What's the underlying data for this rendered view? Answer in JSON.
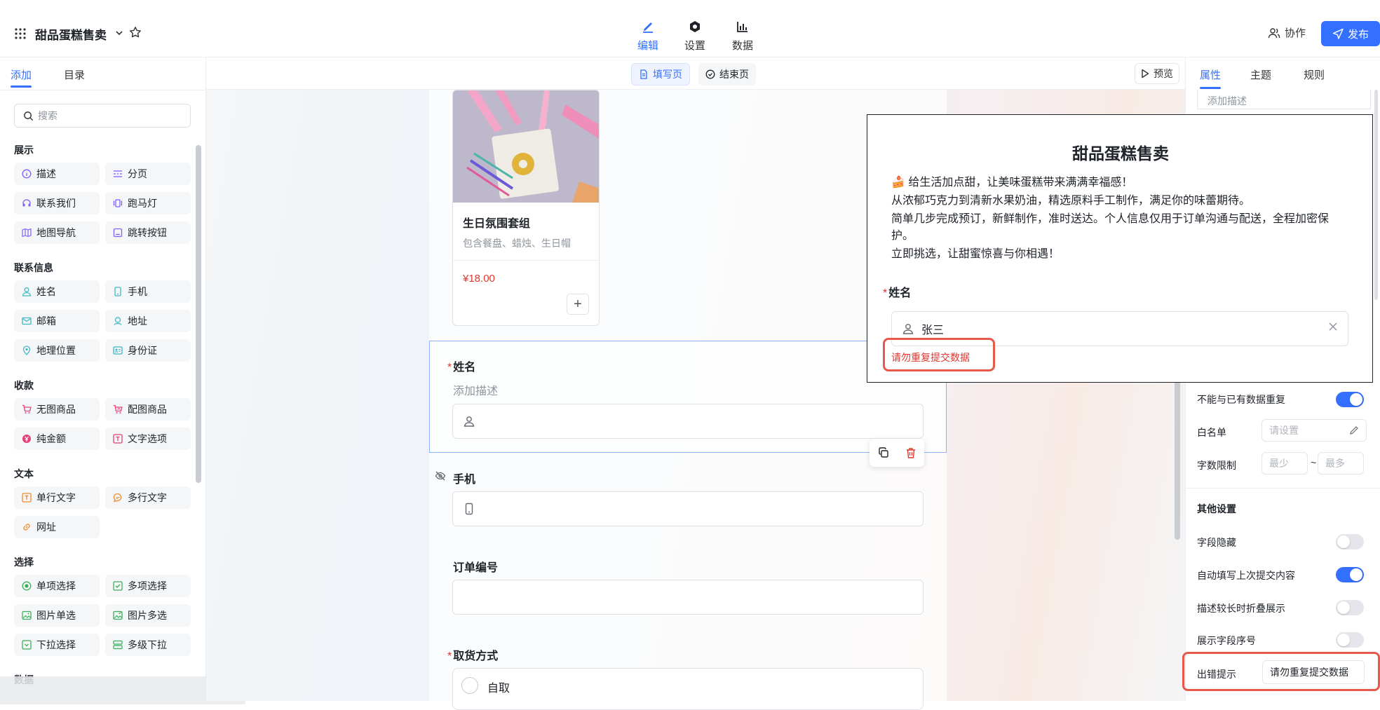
{
  "app": {
    "title": "甜品蛋糕售卖"
  },
  "top_tabs": [
    {
      "label": "编辑"
    },
    {
      "label": "设置"
    },
    {
      "label": "数据"
    }
  ],
  "header_actions": {
    "collab_label": "协作",
    "publish_label": "发布"
  },
  "left_panel": {
    "tabs": [
      {
        "label": "添加"
      },
      {
        "label": "目录"
      }
    ],
    "search_placeholder": "搜索",
    "sections": [
      {
        "title": "展示",
        "items": [
          "描述",
          "分页",
          "联系我们",
          "跑马灯",
          "地图导航",
          "跳转按钮"
        ]
      },
      {
        "title": "联系信息",
        "items": [
          "姓名",
          "手机",
          "邮箱",
          "地址",
          "地理位置",
          "身份证"
        ]
      },
      {
        "title": "收款",
        "items": [
          "无图商品",
          "配图商品",
          "纯金额",
          "文字选项"
        ]
      },
      {
        "title": "文本",
        "items": [
          "单行文字",
          "多行文字",
          "网址"
        ]
      },
      {
        "title": "选择",
        "items": [
          "单项选择",
          "多项选择",
          "图片单选",
          "图片多选",
          "下拉选择",
          "多级下拉"
        ]
      },
      {
        "title": "数据",
        "items": []
      }
    ]
  },
  "page_tabs": [
    {
      "label": "填写页"
    },
    {
      "label": "结束页"
    }
  ],
  "preview_label": "预览",
  "form": {
    "product": {
      "name": "生日氛围套组",
      "desc": "包含餐盘、蜡烛、生日帽",
      "price": "¥18.00",
      "add": "+"
    },
    "fields": [
      {
        "title": "姓名",
        "required": "*",
        "desc": "添加描述"
      },
      {
        "title": "手机",
        "required": ""
      },
      {
        "title": "订单编号",
        "required": ""
      },
      {
        "title": "取货方式",
        "required": "*",
        "option": "自取"
      }
    ]
  },
  "popup": {
    "title": "甜品蛋糕售卖",
    "lines": [
      "🍰 给生活加点甜，让美味蛋糕带来满满幸福感！",
      "从浓郁巧克力到清新水果奶油，精选原料手工制作，满足你的味蕾期待。",
      "简单几步完成预订，新鲜制作，准时送达。个人信息仅用于订单沟通与配送，全程加密保",
      "护。",
      "立即挑选，让甜蜜惊喜与你相遇！"
    ],
    "name_label": "姓名",
    "name_required": "*",
    "name_value": "张三",
    "error_text": "请勿重复提交数据"
  },
  "right_panel": {
    "tabs": [
      {
        "label": "属性"
      },
      {
        "label": "主题"
      },
      {
        "label": "规则"
      }
    ],
    "desc_placeholder": "添加描述",
    "no_duplicate": {
      "label": "不能与已有数据重复",
      "on": true
    },
    "whitelist": {
      "label": "白名单",
      "placeholder": "请设置"
    },
    "char_limit": {
      "label": "字数限制",
      "min_placeholder": "最少",
      "sep": "~",
      "max_placeholder": "最多"
    },
    "other_settings_title": "其他设置",
    "toggles": [
      {
        "label": "字段隐藏",
        "on": false
      },
      {
        "label": "自动填写上次提交内容",
        "on": true
      },
      {
        "label": "描述较长时折叠展示",
        "on": false
      },
      {
        "label": "展示字段序号",
        "on": false
      }
    ],
    "error_hint": {
      "label": "出错提示",
      "value": "请勿重复提交数据"
    }
  },
  "colors": {
    "accent": "#3370ff",
    "error": "#e0362f",
    "highlight": "#e6594c"
  }
}
